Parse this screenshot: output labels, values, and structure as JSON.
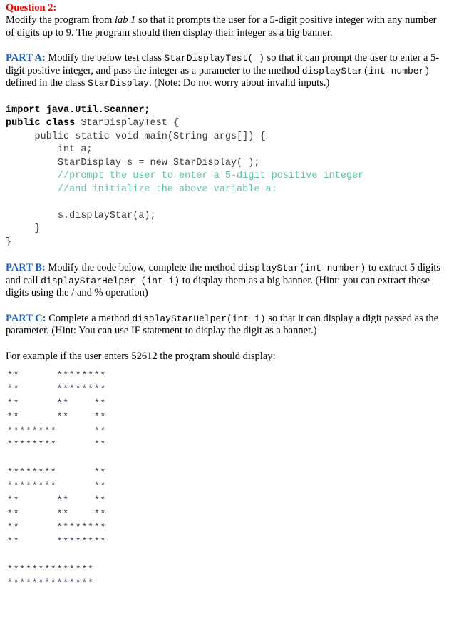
{
  "document": {
    "question_title": "Question 2:",
    "intro": {
      "before_italic": "Modify the program from ",
      "italic": "lab 1",
      "after_italic": " so that it prompts the user for a 5-digit positive integer with any number of digits up to 9. The program should then display their integer as a big banner."
    },
    "part_a": {
      "label": "PART A:",
      "text_1": " Modify the below test class ",
      "code_1": "StarDisplayTest( )",
      "text_2": " so that it can prompt the user to enter a 5-digit positive integer, and pass the integer as a parameter to the method ",
      "code_2": "displayStar(int number)",
      "text_3": "  defined in the class ",
      "code_3": "StarDisplay",
      "text_4": ". (Note: Do not worry about invalid inputs.)"
    },
    "code": {
      "lines": [
        {
          "kind": "bold",
          "text": "import java.Util.Scanner;"
        },
        {
          "kind": "mixed_class",
          "bold": "public class ",
          "plain": "StarDisplayTest {"
        },
        {
          "kind": "plain",
          "text": "     public static void main(String args[]) {"
        },
        {
          "kind": "plain",
          "text": "         int a;"
        },
        {
          "kind": "plain",
          "text": "         StarDisplay s = new StarDisplay( );"
        },
        {
          "kind": "comment",
          "text": "         //prompt the user to enter a 5-digit positive integer"
        },
        {
          "kind": "comment",
          "text": "         //and initialize the above variable a:"
        },
        {
          "kind": "plain",
          "text": ""
        },
        {
          "kind": "plain",
          "text": "         s.displayStar(a);"
        },
        {
          "kind": "plain",
          "text": "     }"
        },
        {
          "kind": "plain",
          "text": "}"
        }
      ]
    },
    "part_b": {
      "label": "PART B:",
      "text_1": " Modify the code below, complete the method ",
      "code_1": "displayStar(int number)",
      "text_2": " to extract 5 digits and call ",
      "code_2": "displayStarHelper (int i)",
      "text_3": " to display them as a big banner. (Hint: you can extract these digits using the / and % operation)"
    },
    "part_c": {
      "label": "PART C:",
      "text_1": " Complete a method ",
      "code_1": "displayStarHelper(int i)",
      "text_2": " so that it can display a digit passed as the parameter. (Hint: You can use IF statement to display the digit as a banner.)"
    },
    "example_intro": "For example if the user enters 52612 the program should display:",
    "example_number": "52612",
    "banner": {
      "blocks": [
        {
          "digit": "5",
          "rows": [
            "**      ********",
            "**      ********",
            "**      **    **",
            "**      **    **",
            "********      **",
            "********      **"
          ]
        },
        {
          "digit": "2",
          "rows": [
            "********      **",
            "********      **",
            "**      **    **",
            "**      **    **",
            "**      ********",
            "**      ********"
          ]
        },
        {
          "digit": "6",
          "rows": [
            "**************",
            "**************"
          ]
        }
      ]
    }
  }
}
